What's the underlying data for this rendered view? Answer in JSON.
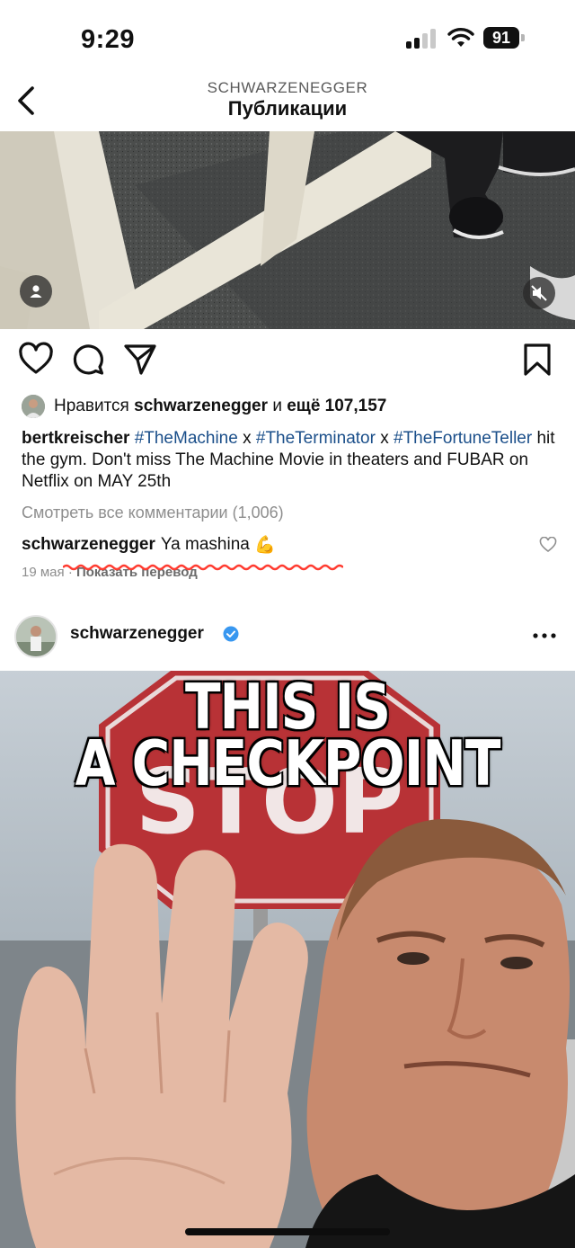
{
  "status_bar": {
    "time": "9:29",
    "battery": "91"
  },
  "header": {
    "username": "SCHWARZENEGGER",
    "title": "Публикации"
  },
  "post1": {
    "likes": {
      "prefix": "Нравится",
      "user": "schwarzenegger",
      "conj": "и",
      "count": "ещё 107,157"
    },
    "caption": {
      "user": "bertkreischer",
      "tag1": "#TheMachine",
      "x1": "x",
      "tag2": "#TheTerminator",
      "x2": "x",
      "tag3": "#TheFortuneTeller",
      "text": "hit the gym. Don't miss The Machine Movie in theaters and FUBAR on Netflix on MAY 25th"
    },
    "view_comments": "Смотреть все комментарии (1,006)",
    "comment": {
      "user": "schwarzenegger",
      "text": "Ya mashina",
      "emoji": "💪"
    },
    "meta": {
      "date": "19 мая",
      "sep": "·",
      "translate": "Показать перевод"
    }
  },
  "post2": {
    "username": "schwarzenegger",
    "meme_line1": "THIS IS",
    "meme_line2": "A CHECKPOINT",
    "sign_text": "STOP"
  },
  "icons": [
    "back-chevron-icon",
    "heart-icon",
    "comment-icon",
    "share-icon",
    "bookmark-icon",
    "user-tag-icon",
    "muted-speaker-icon",
    "verified-badge-icon",
    "more-icon"
  ],
  "colors": {
    "hashtag": "#1b4f8a",
    "verified": "#3897f0",
    "squiggle": "#ff3b30"
  }
}
